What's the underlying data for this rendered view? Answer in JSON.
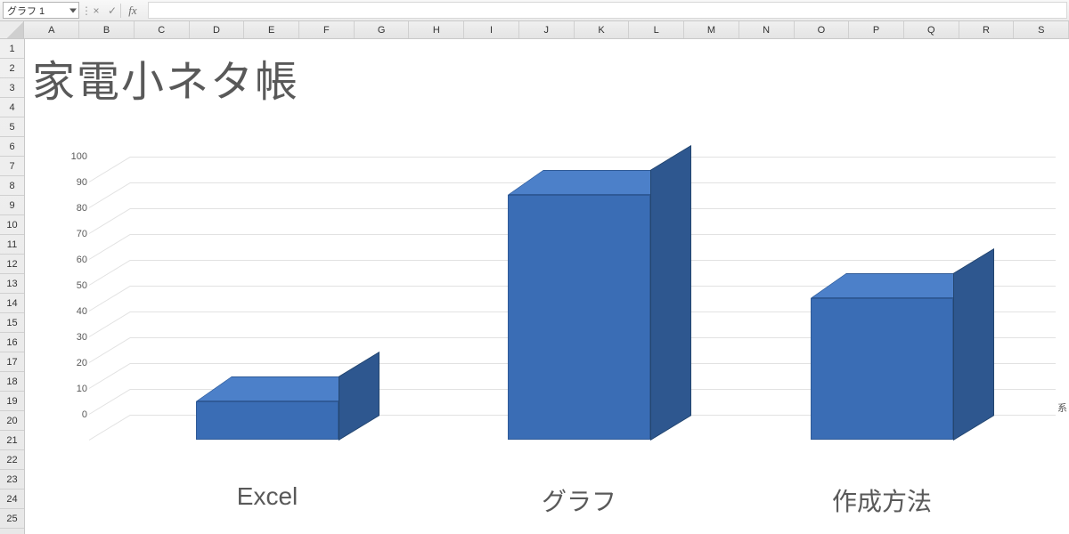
{
  "formula_bar": {
    "name_box_value": "グラフ 1",
    "cancel_icon": "×",
    "enter_icon": "✓",
    "fx_label": "fx",
    "formula_value": ""
  },
  "columns": [
    "A",
    "B",
    "C",
    "D",
    "E",
    "F",
    "G",
    "H",
    "I",
    "J",
    "K",
    "L",
    "M",
    "N",
    "O",
    "P",
    "Q",
    "R",
    "S"
  ],
  "rows": [
    "1",
    "2",
    "3",
    "4",
    "5",
    "6",
    "7",
    "8",
    "9",
    "10",
    "11",
    "12",
    "13",
    "14",
    "15",
    "16",
    "17",
    "18",
    "19",
    "20",
    "21",
    "22",
    "23",
    "24",
    "25"
  ],
  "chart": {
    "title": "家電小ネタ帳",
    "series_legend": "系"
  },
  "chart_data": {
    "type": "bar",
    "categories": [
      "Excel",
      "グラフ",
      "作成方法"
    ],
    "values": [
      15,
      95,
      55
    ],
    "title": "家電小ネタ帳",
    "xlabel": "",
    "ylabel": "",
    "ylim": [
      0,
      100
    ],
    "yticks": [
      0,
      10,
      20,
      30,
      40,
      50,
      60,
      70,
      80,
      90,
      100
    ]
  }
}
